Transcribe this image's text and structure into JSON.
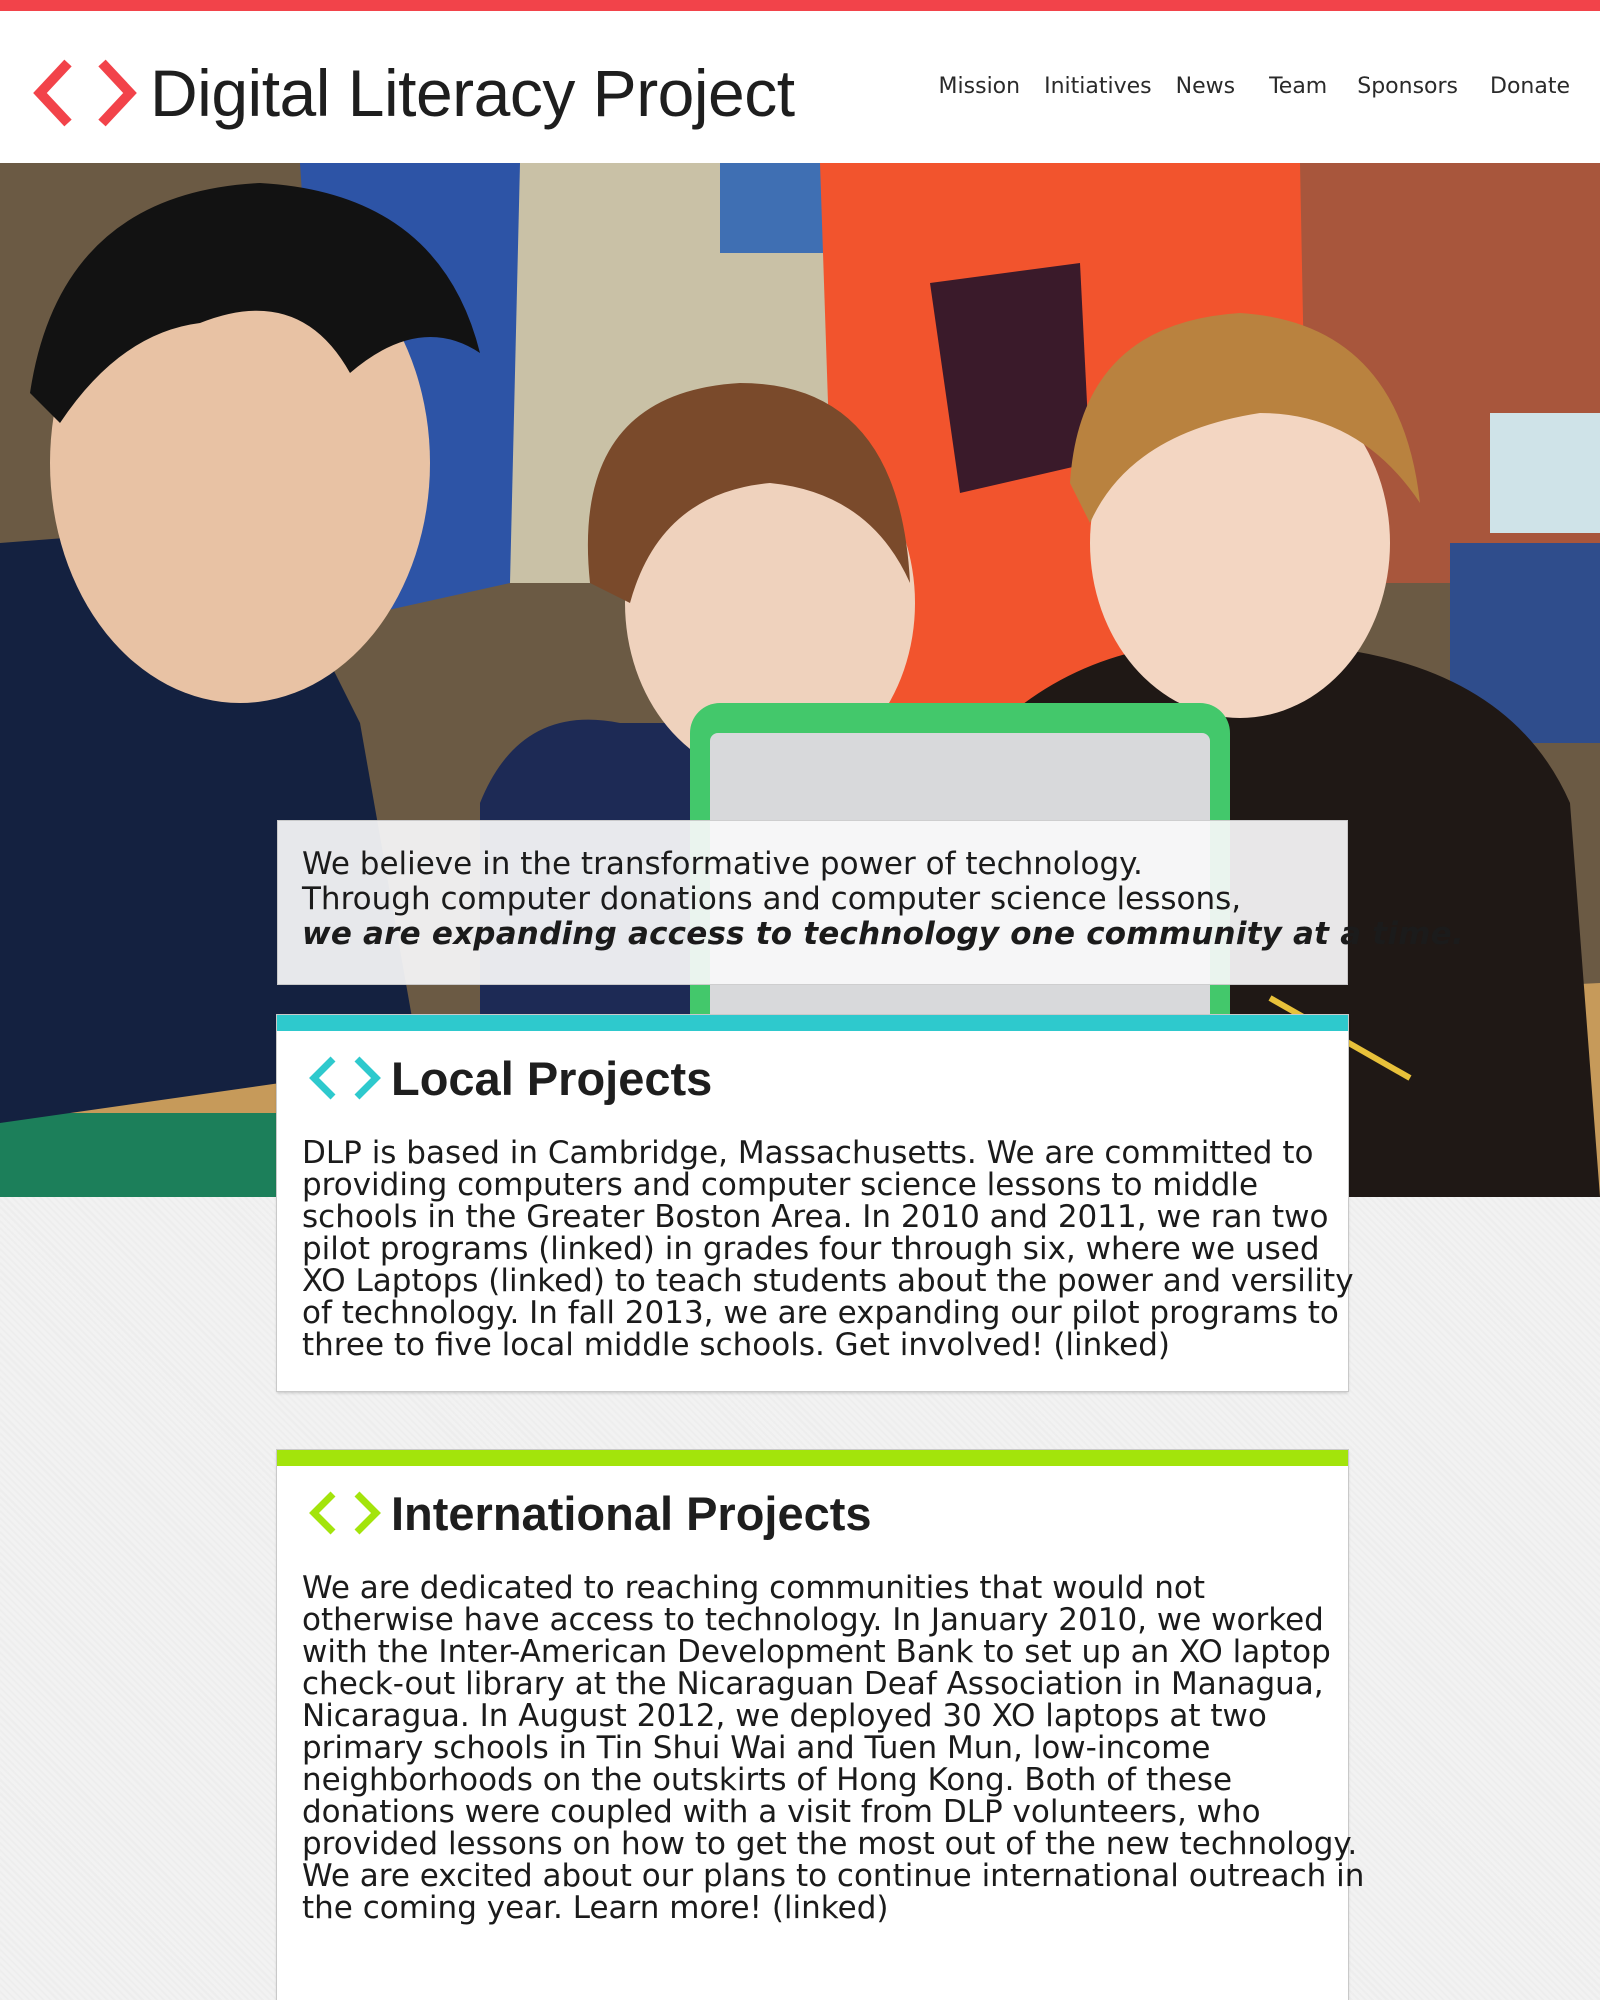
{
  "header": {
    "logo_text": "Digital Literacy Project",
    "nav": [
      {
        "label": "Mission"
      },
      {
        "label": "Initiatives"
      },
      {
        "label": "News"
      },
      {
        "label": "Team"
      },
      {
        "label": "Sponsors"
      },
      {
        "label": "Donate"
      }
    ]
  },
  "hero": {
    "tagline_lines": [
      "We believe in the transformative power of technology.",
      "Through computer donations and computer science lessons,"
    ],
    "tagline_emphasis": "we are expanding access to technology one community at a time."
  },
  "cards": {
    "local": {
      "title": "Local Projects",
      "lines": [
        "DLP is based in Cambridge, Massachusetts. We are committed to",
        "providing computers and computer science lessons to middle",
        "schools in the Greater Boston Area. In 2010 and 2011, we ran two",
        "pilot programs (linked) in grades four through six, where we used",
        "XO Laptops (linked) to teach students about the power and versility",
        "of technology. In fall 2013, we are expanding our pilot programs to",
        "three to five local middle schools. Get involved! (linked)"
      ]
    },
    "international": {
      "title": "International Projects",
      "lines": [
        "We are dedicated to reaching communities that would not",
        "otherwise have access to technology. In January 2010, we worked",
        "with the Inter-American Development Bank to set up an XO laptop",
        "check-out library at the Nicaraguan Deaf Association in Managua,",
        "Nicaragua. In August 2012, we deployed 30 XO laptops at two",
        "primary schools in Tin Shui Wai and Tuen Mun, low-income",
        "neighborhoods on the outskirts of Hong Kong. Both of these",
        "donations were coupled with a visit from DLP volunteers, who",
        "provided lessons on how to get the most out of the new technology.",
        "We are excited about our plans to continue international outreach in",
        "the coming year. Learn more! (linked)"
      ]
    }
  },
  "colors": {
    "brand_red": "#f2434a",
    "local_accent": "#2ec9cd",
    "international_accent": "#a3e40b",
    "text": "#1b1b1b"
  },
  "icons": {
    "logo": "angle-brackets-icon",
    "section": "angle-brackets-icon"
  }
}
